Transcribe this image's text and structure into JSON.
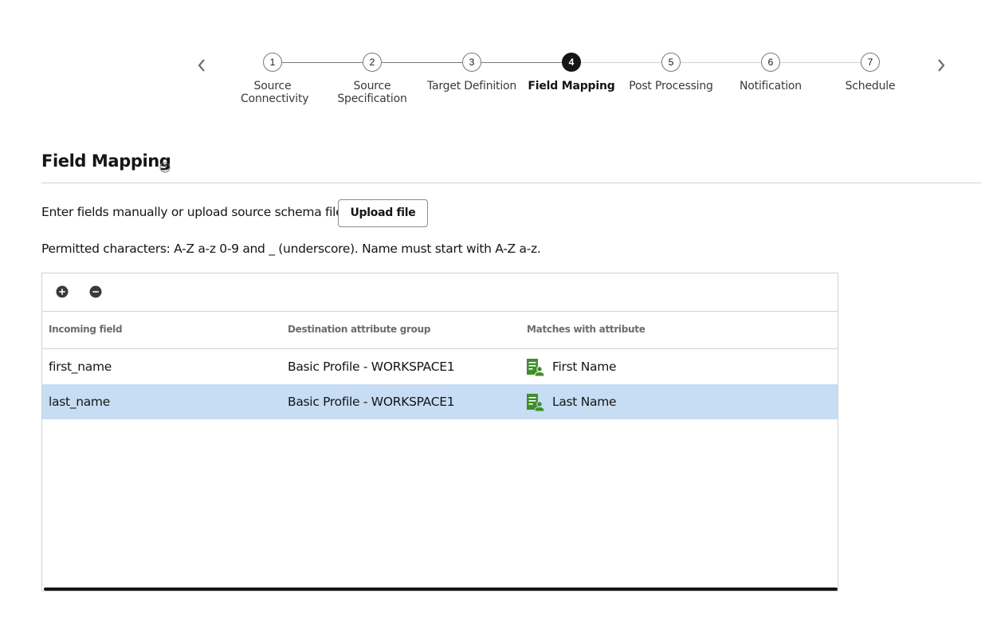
{
  "train": {
    "steps": [
      {
        "number": "1",
        "label": "Source Connectivity"
      },
      {
        "number": "2",
        "label": "Source Specification"
      },
      {
        "number": "3",
        "label": "Target Definition"
      },
      {
        "number": "4",
        "label": "Field Mapping"
      },
      {
        "number": "5",
        "label": "Post Processing"
      },
      {
        "number": "6",
        "label": "Notification"
      },
      {
        "number": "7",
        "label": "Schedule"
      }
    ],
    "current_step": 4
  },
  "section": {
    "title": "Field Mapping",
    "instruction": "Enter fields manually or upload source schema file",
    "upload_button": "Upload file",
    "permitted": "Permitted characters: A-Z a-z 0-9 and _ (underscore). Name must start with A-Z a-z."
  },
  "table": {
    "columns": [
      "Incoming field",
      "Destination attribute group",
      "Matches with attribute"
    ],
    "rows": [
      {
        "incoming": "first_name",
        "group": "Basic Profile - WORKSPACE1",
        "attribute": "First Name",
        "selected": false
      },
      {
        "incoming": "last_name",
        "group": "Basic Profile - WORKSPACE1",
        "attribute": "Last Name",
        "selected": true
      }
    ]
  },
  "icons": {
    "prev": "chevron-left-icon",
    "next": "chevron-right-icon",
    "help": "help-circle-icon",
    "add": "plus-circle-icon",
    "remove": "minus-circle-icon",
    "attribute": "profile-attribute-icon"
  },
  "colors": {
    "selected_row": "#c6ddf3",
    "attribute_icon": "#3f8e2a",
    "current_step": "#161513"
  }
}
